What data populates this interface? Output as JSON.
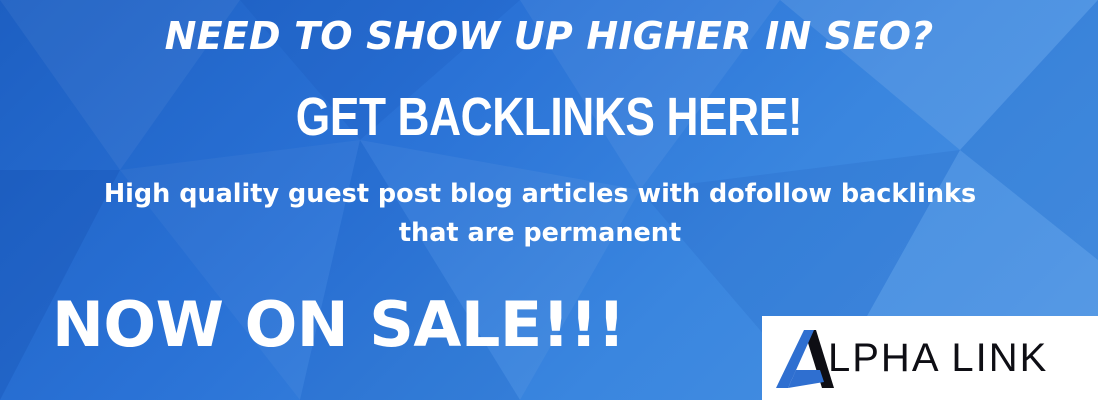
{
  "banner": {
    "headline_top": "NEED TO SHOW UP HIGHER IN SEO?",
    "headline_main": "GET BACKLINKS HERE!",
    "subtitle_line1": "High quality guest post blog articles with dofollow backlinks",
    "subtitle_line2": "that are permanent",
    "sale_text": "NOW ON SALE!!!"
  },
  "logo": {
    "brand_name": "ALPHA LINK",
    "text_after_mark": "LPHA LINK",
    "mark_icon": "alpha-a-icon"
  },
  "colors": {
    "background_dark": "#1d5fc2",
    "background_light": "#4a93e3",
    "text": "#ffffff",
    "logo_blue": "#2f6fd0",
    "logo_dark": "#0e0e14"
  }
}
